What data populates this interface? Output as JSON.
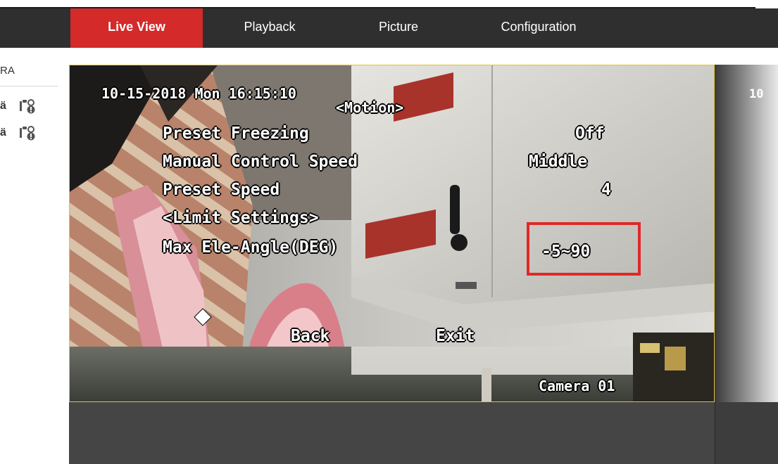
{
  "nav": {
    "tabs": [
      {
        "label": "Live View",
        "active": true
      },
      {
        "label": "Playback",
        "active": false
      },
      {
        "label": "Picture",
        "active": false
      },
      {
        "label": "Configuration",
        "active": false
      }
    ]
  },
  "sidebar": {
    "title": "RA",
    "items": [
      {
        "glyph": "ä",
        "icon": "camera-settings-icon"
      },
      {
        "glyph": "ä",
        "icon": "camera-settings-icon"
      }
    ]
  },
  "osd": {
    "timestamp": "10-15-2018 Mon 16:15:10",
    "menu_title": "<Motion>",
    "rows": [
      {
        "label": "Preset Freezing",
        "value": "Off"
      },
      {
        "label": "Manual Control Speed",
        "value": "Middle"
      },
      {
        "label": "Preset Speed",
        "value": "4"
      },
      {
        "label": "<Limit Settings>",
        "value": ""
      },
      {
        "label": "Max Ele-Angle(DEG)",
        "value": "-5~90"
      }
    ],
    "back": "Back",
    "exit": "Exit",
    "camera_name": "Camera 01"
  },
  "second_view": {
    "timestamp_fragment": "10"
  },
  "colors": {
    "nav_bg": "#2f2f2f",
    "active_tab": "#d42a2a",
    "highlight_box": "#e12828",
    "video_border": "#e0c23a"
  }
}
